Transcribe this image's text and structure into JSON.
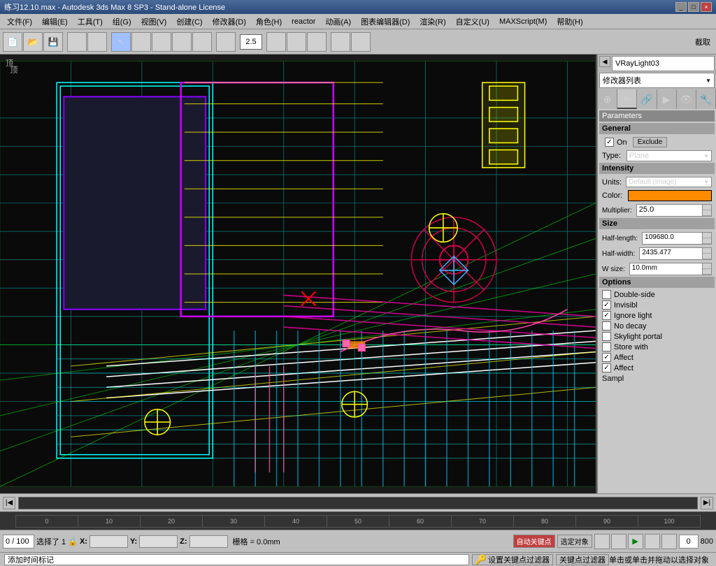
{
  "titleBar": {
    "title": "练习12.10.max - Autodesk 3ds Max 8 SP3  -  Stand-alone License",
    "controls": [
      "_",
      "□",
      "×"
    ]
  },
  "menuBar": {
    "items": [
      "文件(F)",
      "编辑(E)",
      "工具(T)",
      "组(G)",
      "视图(V)",
      "创建(C)",
      "修改器(D)",
      "角色(H)",
      "reactor",
      "动画(A)",
      "图表编辑器(D)",
      "渲染(R)",
      "自定义(U)",
      "MAXScript(M)",
      "帮助(H)"
    ]
  },
  "toolbar": {
    "zoom_value": "2.5",
    "viewport_label": "顶"
  },
  "rightPanel": {
    "objectName": "VRayLight03",
    "modifierStack": "修改器列表",
    "tabs": [
      "▶",
      "⚲",
      "✦",
      "◆",
      "🔧",
      "✿",
      "▲"
    ],
    "sections": {
      "parameters": "Parameters",
      "general": "General",
      "intensity": "Intensity",
      "size": "Size",
      "options": "Options"
    },
    "general": {
      "on_label": "On",
      "on_checked": true,
      "exclude_label": "Exclude",
      "type_label": "Type:",
      "type_value": "Plane"
    },
    "intensity": {
      "units_label": "Units:",
      "units_value": "Default (image)",
      "color_label": "Color:",
      "color_hex": "#ff8c00",
      "multiplier_label": "Multiplier:",
      "multiplier_value": "25.0"
    },
    "size": {
      "half_length_label": "Half-length:",
      "half_length_value": "109680.0",
      "half_width_label": "Half-width:",
      "half_width_value": "2435.477",
      "w_size_label": "W size:",
      "w_size_value": "10.0mm"
    },
    "options": {
      "double_side_label": "Double-side",
      "double_side_checked": false,
      "invisible_label": "Invisibl",
      "invisible_checked": true,
      "ignore_light_label": "Ignore light",
      "ignore_light_checked": true,
      "no_decay_label": "No decay",
      "no_decay_checked": false,
      "skylight_label": "Skylight portal",
      "skylight_checked": false,
      "store_with_label": "Store with",
      "store_with_checked": false,
      "affect1_label": "Affect",
      "affect1_checked": true,
      "affect2_label": "Affect",
      "affect2_checked": true,
      "sampl_label": "Sampl"
    }
  },
  "timeline": {
    "position": "0 / 100",
    "ticks": [
      "0",
      "10",
      "20",
      "30",
      "40",
      "50",
      "60",
      "70",
      "80",
      "90",
      "100"
    ]
  },
  "statusBar": {
    "selection": "选择了 1  🔒",
    "x_label": "X:",
    "x_value": "",
    "y_label": "Y:",
    "y_value": "",
    "z_label": "Z:",
    "z_value": "",
    "grid_label": "栅格 = 0.0mm",
    "autokey_label": "自动关键点",
    "select_object": "选定对象",
    "add_time": "添加时间标记",
    "set_key": "设置关键点过滤器",
    "close_key": "关键点过滤器",
    "frame_value": "0",
    "total_frames": "800"
  },
  "bottomStatus": {
    "message": "单击或单击并拖动以选择对象"
  }
}
